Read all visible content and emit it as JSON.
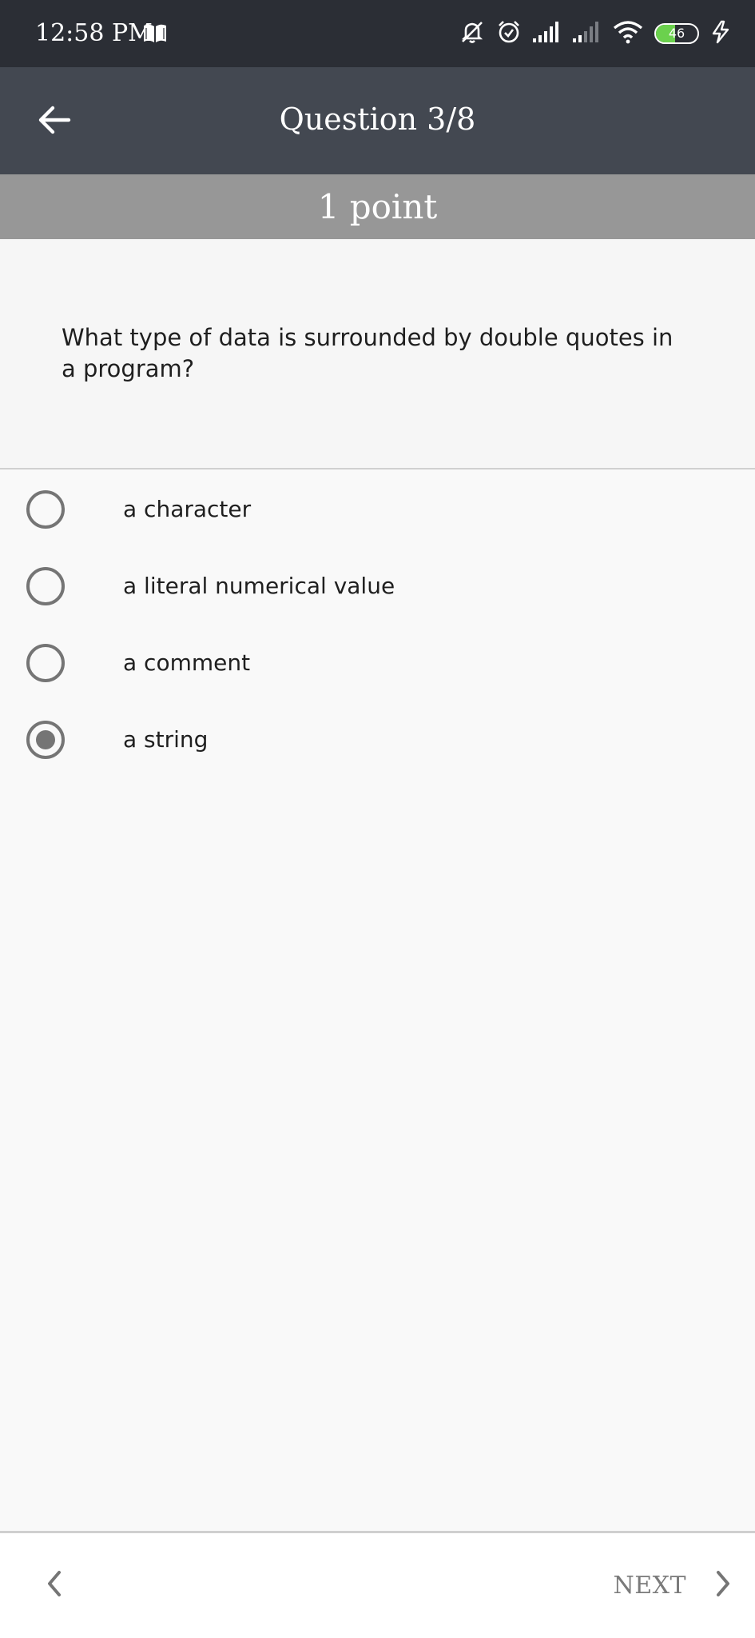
{
  "status_bar": {
    "time": "12:58 PM",
    "battery_level": "46",
    "battery_fraction": 0.46,
    "icons": [
      "book-icon",
      "bell-muted-icon",
      "alarm-icon",
      "signal-icon",
      "signal-weak-icon",
      "wifi-icon",
      "battery-icon",
      "charging-icon"
    ]
  },
  "header": {
    "title": "Question 3/8",
    "back_icon": "arrow-left-icon"
  },
  "points": {
    "label": "1 point"
  },
  "question": {
    "text": "What type of data is surrounded by double quotes in a program?"
  },
  "options": [
    {
      "label": "a character",
      "selected": false
    },
    {
      "label": "a literal numerical value",
      "selected": false
    },
    {
      "label": "a comment",
      "selected": false
    },
    {
      "label": "a string",
      "selected": true
    }
  ],
  "footer": {
    "next_label": "NEXT",
    "prev_icon": "chevron-left-icon",
    "next_icon": "chevron-right-icon"
  },
  "colors": {
    "status_bar": "#2b2e35",
    "app_bar": "#434851",
    "points_bar": "#979797",
    "radio": "#757575",
    "battery_fill": "#6bd14d"
  }
}
